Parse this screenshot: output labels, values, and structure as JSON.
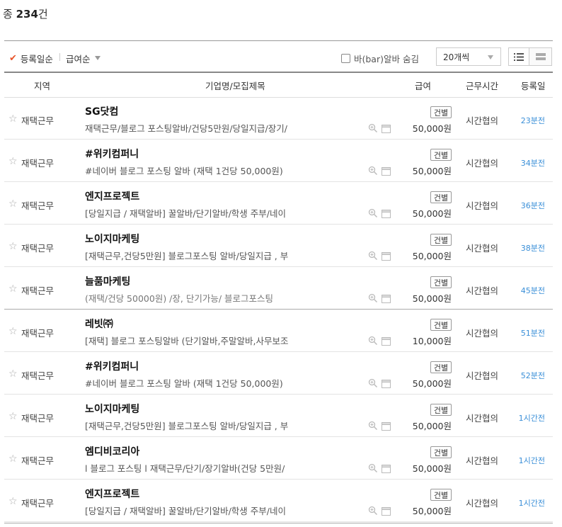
{
  "summary": {
    "prefix": "종 ",
    "count": "234",
    "suffix": "건"
  },
  "toolbar": {
    "sort_date": "등록일순",
    "sort_pay": "급여순",
    "hide_bar": "바(bar)알바 숨김",
    "per_page": "20개씩"
  },
  "columns": {
    "region": "지역",
    "company": "기업명/모집제목",
    "pay": "급여",
    "hours": "근무시간",
    "posted": "등록일"
  },
  "rows": [
    {
      "region": "재택근무",
      "company": "SG닷컴",
      "title": "재택근무/블로그 포스팅알바/건당5만원/당일지급/장기/",
      "badge": "건별",
      "pay": "50,000원",
      "hours": "시간협의",
      "posted": "23분전"
    },
    {
      "region": "재택근무",
      "company": "#위키컴퍼니",
      "title": "#네이버 블로그 포스팅 알바 (재택 1건당 50,000원)",
      "badge": "건별",
      "pay": "50,000원",
      "hours": "시간협의",
      "posted": "34분전"
    },
    {
      "region": "재택근무",
      "company": "엔지프로젝트",
      "title": "[당일지급 / 재택알바] 꿀알바/단기알바/학생 주부/네이",
      "badge": "건별",
      "pay": "50,000원",
      "hours": "시간협의",
      "posted": "36분전"
    },
    {
      "region": "재택근무",
      "company": "노이지마케팅",
      "title": "[재택근무,건당5만원] 블로그포스팅 알바/당일지급 , 부",
      "badge": "건별",
      "pay": "50,000원",
      "hours": "시간협의",
      "posted": "38분전"
    },
    {
      "region": "재택근무",
      "company": "늘품마케팅",
      "title": "(재택/건당 50000원) /장, 단기가능/ 블로그포스팅",
      "badge": "건별",
      "pay": "50,000원",
      "hours": "시간협의",
      "posted": "45분전"
    },
    {
      "region": "재택근무",
      "company": "레빗㈜",
      "title": "[재택] 블로그 포스팅알바 (단기알바,주말알바,사무보조",
      "badge": "건별",
      "pay": "10,000원",
      "hours": "시간협의",
      "posted": "51분전"
    },
    {
      "region": "재택근무",
      "company": "#위키컴퍼니",
      "title": "#네이버 블로그 포스팅 알바 (재택 1건당 50,000원)",
      "badge": "건별",
      "pay": "50,000원",
      "hours": "시간협의",
      "posted": "52분전"
    },
    {
      "region": "재택근무",
      "company": "노이지마케팅",
      "title": "[재택근무,건당5만원] 블로그포스팅 알바/당일지급 , 부",
      "badge": "건별",
      "pay": "50,000원",
      "hours": "시간협의",
      "posted": "1시간전"
    },
    {
      "region": "재택근무",
      "company": "엠디비코리아",
      "title": "l 블로그 포스팅 l 재택근무/단기/장기알바(건당 5만원/",
      "badge": "건별",
      "pay": "50,000원",
      "hours": "시간협의",
      "posted": "1시간전"
    },
    {
      "region": "재택근무",
      "company": "엔지프로젝트",
      "title": "[당일지급 / 재택알바] 꿀알바/단기알바/학생 주부/네이",
      "badge": "건별",
      "pay": "50,000원",
      "hours": "시간협의",
      "posted": "1시간전"
    }
  ]
}
